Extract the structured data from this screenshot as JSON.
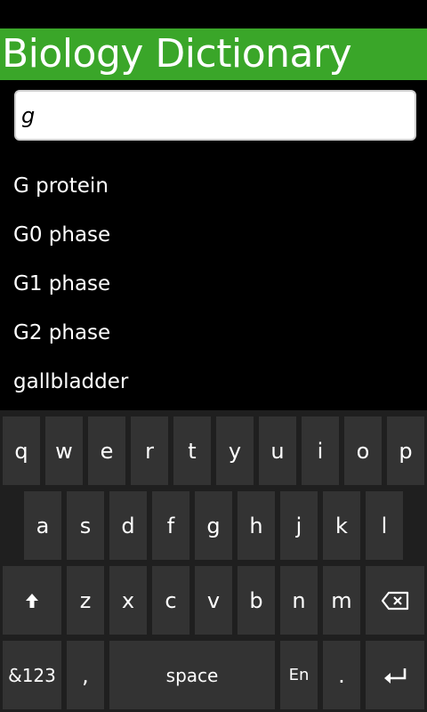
{
  "app": {
    "title": "Biology Dictionary"
  },
  "search": {
    "value": "g",
    "placeholder": ""
  },
  "results": [
    "G protein",
    "G0 phase",
    "G1 phase",
    "G2 phase",
    "gallbladder"
  ],
  "keyboard": {
    "row1": [
      "q",
      "w",
      "e",
      "r",
      "t",
      "y",
      "u",
      "i",
      "o",
      "p"
    ],
    "row2": [
      "a",
      "s",
      "d",
      "f",
      "g",
      "h",
      "j",
      "k",
      "l"
    ],
    "row3": [
      "z",
      "x",
      "c",
      "v",
      "b",
      "n",
      "m"
    ],
    "symbols_label": "&123",
    "comma_label": ",",
    "space_label": "space",
    "language_label": "En",
    "period_label": ".",
    "shift_icon": "shift-arrow-icon",
    "backspace_icon": "backspace-icon",
    "enter_icon": "enter-icon"
  },
  "colors": {
    "title_bar": "#3aa629",
    "background": "#000000",
    "keyboard_bg": "#1f1f1f",
    "key_bg": "#333333"
  }
}
